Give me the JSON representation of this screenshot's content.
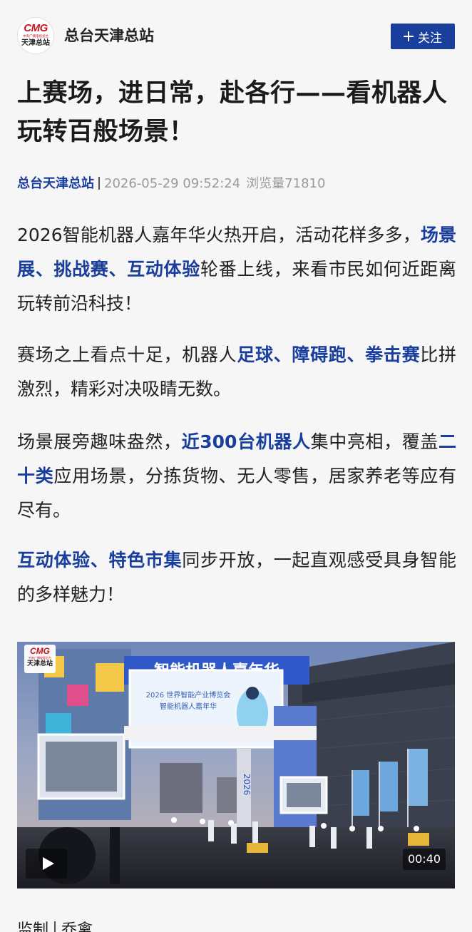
{
  "header": {
    "logo": {
      "brand": "CMG",
      "subtitle": "中央广播电视总台",
      "name": "天津总站"
    },
    "account_name": "总台天津总站",
    "follow_label": "关注",
    "follow_icon": "plus-icon"
  },
  "article": {
    "title": "上赛场，进日常，赴各行——看机器人玩转百般场景！",
    "source": "总台天津总站",
    "datetime": "2026-05-29 09:52:24",
    "views": "浏览量71810",
    "paragraphs": [
      [
        {
          "text": "2026智能机器人嘉年华火热开启，活动花样多多，",
          "highlight": false
        },
        {
          "text": "场景展、挑战赛、互动体验",
          "highlight": true
        },
        {
          "text": "轮番上线，来看市民如何近距离玩转前沿科技！",
          "highlight": false
        }
      ],
      [
        {
          "text": "赛场之上看点十足，机器人",
          "highlight": false
        },
        {
          "text": "足球、障碍跑、拳击赛",
          "highlight": true
        },
        {
          "text": "比拼激烈，精彩对决吸睛无数。",
          "highlight": false
        }
      ],
      [
        {
          "text": "场景展旁趣味盎然，",
          "highlight": false
        },
        {
          "text": "近300台机器人",
          "highlight": true
        },
        {
          "text": "集中亮相，覆盖",
          "highlight": false
        },
        {
          "text": "二十类",
          "highlight": true
        },
        {
          "text": "应用场景，分拣货物、无人零售，居家养老等应有尽有。",
          "highlight": false
        }
      ],
      [
        {
          "text": "互动体验、特色市集",
          "highlight": true
        },
        {
          "text": "同步开放，一起直观感受具身智能的多样魅力！",
          "highlight": false
        }
      ]
    ]
  },
  "video": {
    "banner_text": "智能机器人嘉年华",
    "screen_line1": "2026 世界智能产业博览会",
    "screen_line2": "智能机器人嘉年华",
    "pillar_text": "2026",
    "watermark": {
      "brand": "CMG",
      "subtitle": "中央广播电视总台",
      "name": "天津总站"
    },
    "duration": "00:40",
    "play_icon": "play-icon"
  },
  "footer": {
    "editor_label": "监制",
    "editor_name": "乔禽"
  },
  "colors": {
    "accent": "#1a3e9c",
    "brand_red": "#c8161d",
    "text": "#222222",
    "meta": "#9a9a9a",
    "background": "#f6f6f6"
  }
}
